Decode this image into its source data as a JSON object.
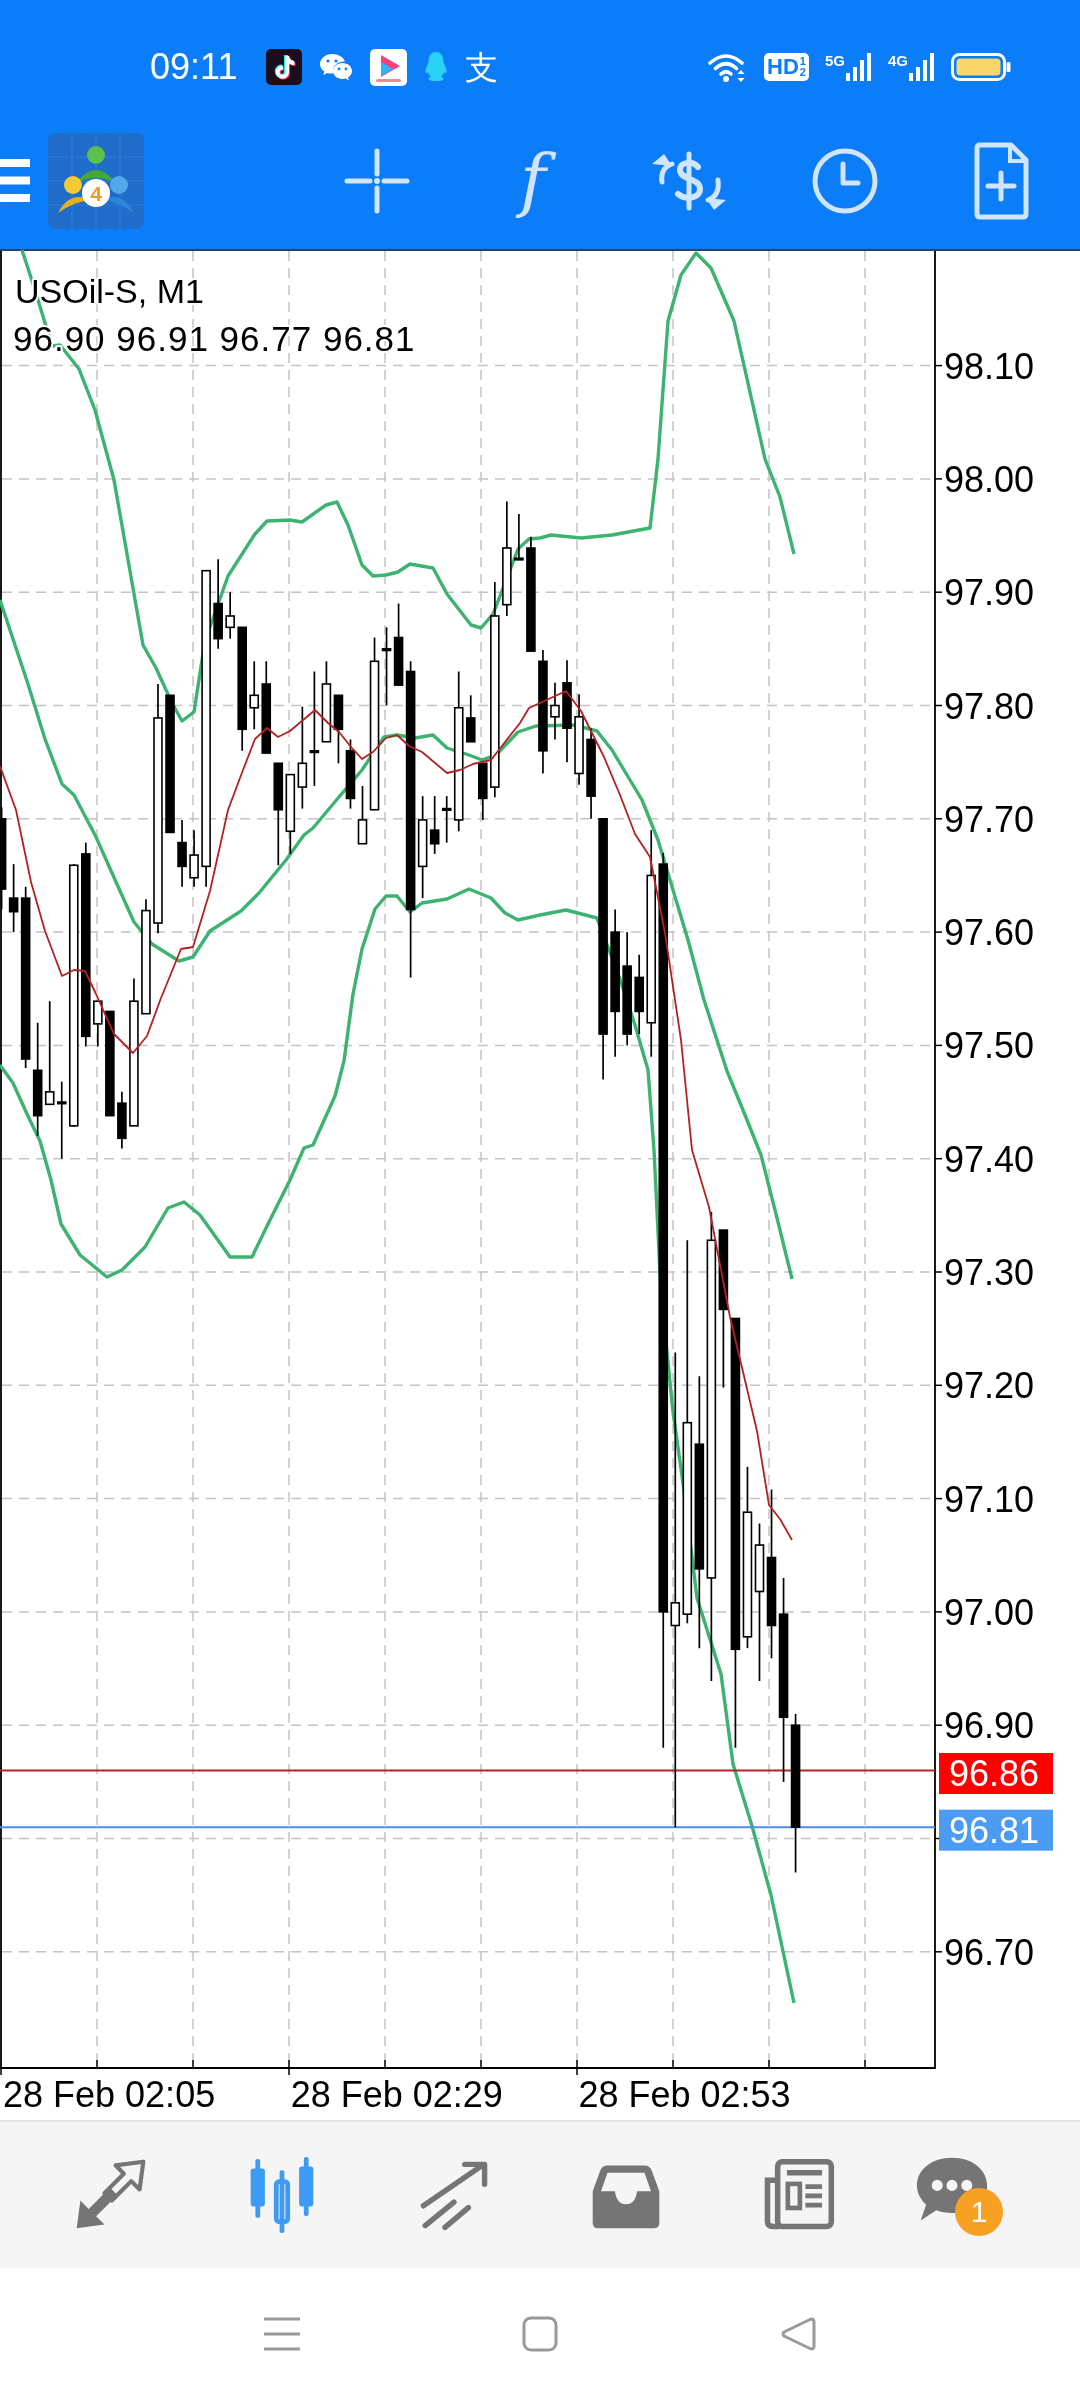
{
  "status_bar": {
    "time": "09:11",
    "notification_icons": [
      {
        "kind": "music-note"
      },
      {
        "kind": "chat-bubbles"
      },
      {
        "kind": "play-tile"
      },
      {
        "kind": "penguin"
      },
      {
        "kind": "glyph",
        "text": "支"
      }
    ],
    "hd_badge": {
      "text": "HD",
      "superscript": "1",
      "subscript": "2"
    },
    "networks": [
      {
        "label": "5G"
      },
      {
        "label": "4G"
      }
    ]
  },
  "toolbar": {
    "logo_text": "4",
    "buttons": [
      {
        "kind": "crosshair"
      },
      {
        "kind": "function",
        "glyph": "f"
      },
      {
        "kind": "trade"
      },
      {
        "kind": "clock"
      },
      {
        "kind": "new-document"
      }
    ]
  },
  "chart": {
    "symbol": "USOil-S, M1",
    "ohlc": "96.90 96.91 96.77 96.81",
    "price_axis": {
      "upper_labels": [
        "98.10",
        "98.00",
        "97.90",
        "97.80",
        "97.70",
        "97.60",
        "97.50",
        "97.40",
        "97.30",
        "97.20",
        "97.10",
        "97.00",
        "96.90"
      ],
      "lower_labels": [
        "96.70"
      ]
    },
    "price_tags": [
      {
        "kind": "ask",
        "text": "96.86"
      },
      {
        "kind": "bid",
        "text": "96.81"
      }
    ],
    "time_labels": [
      "28 Feb 02:05",
      "28 Feb 02:29",
      "28 Feb 02:53"
    ]
  },
  "bottom_nav": {
    "tabs": [
      {
        "kind": "quotes",
        "selected": false
      },
      {
        "kind": "chart",
        "selected": true
      },
      {
        "kind": "trade",
        "selected": false
      },
      {
        "kind": "history",
        "selected": false
      },
      {
        "kind": "news",
        "selected": false
      },
      {
        "kind": "messages",
        "selected": false,
        "badge": "1"
      }
    ]
  },
  "system_nav": {
    "buttons": [
      {
        "kind": "menu"
      },
      {
        "kind": "home"
      },
      {
        "kind": "back"
      }
    ]
  }
}
